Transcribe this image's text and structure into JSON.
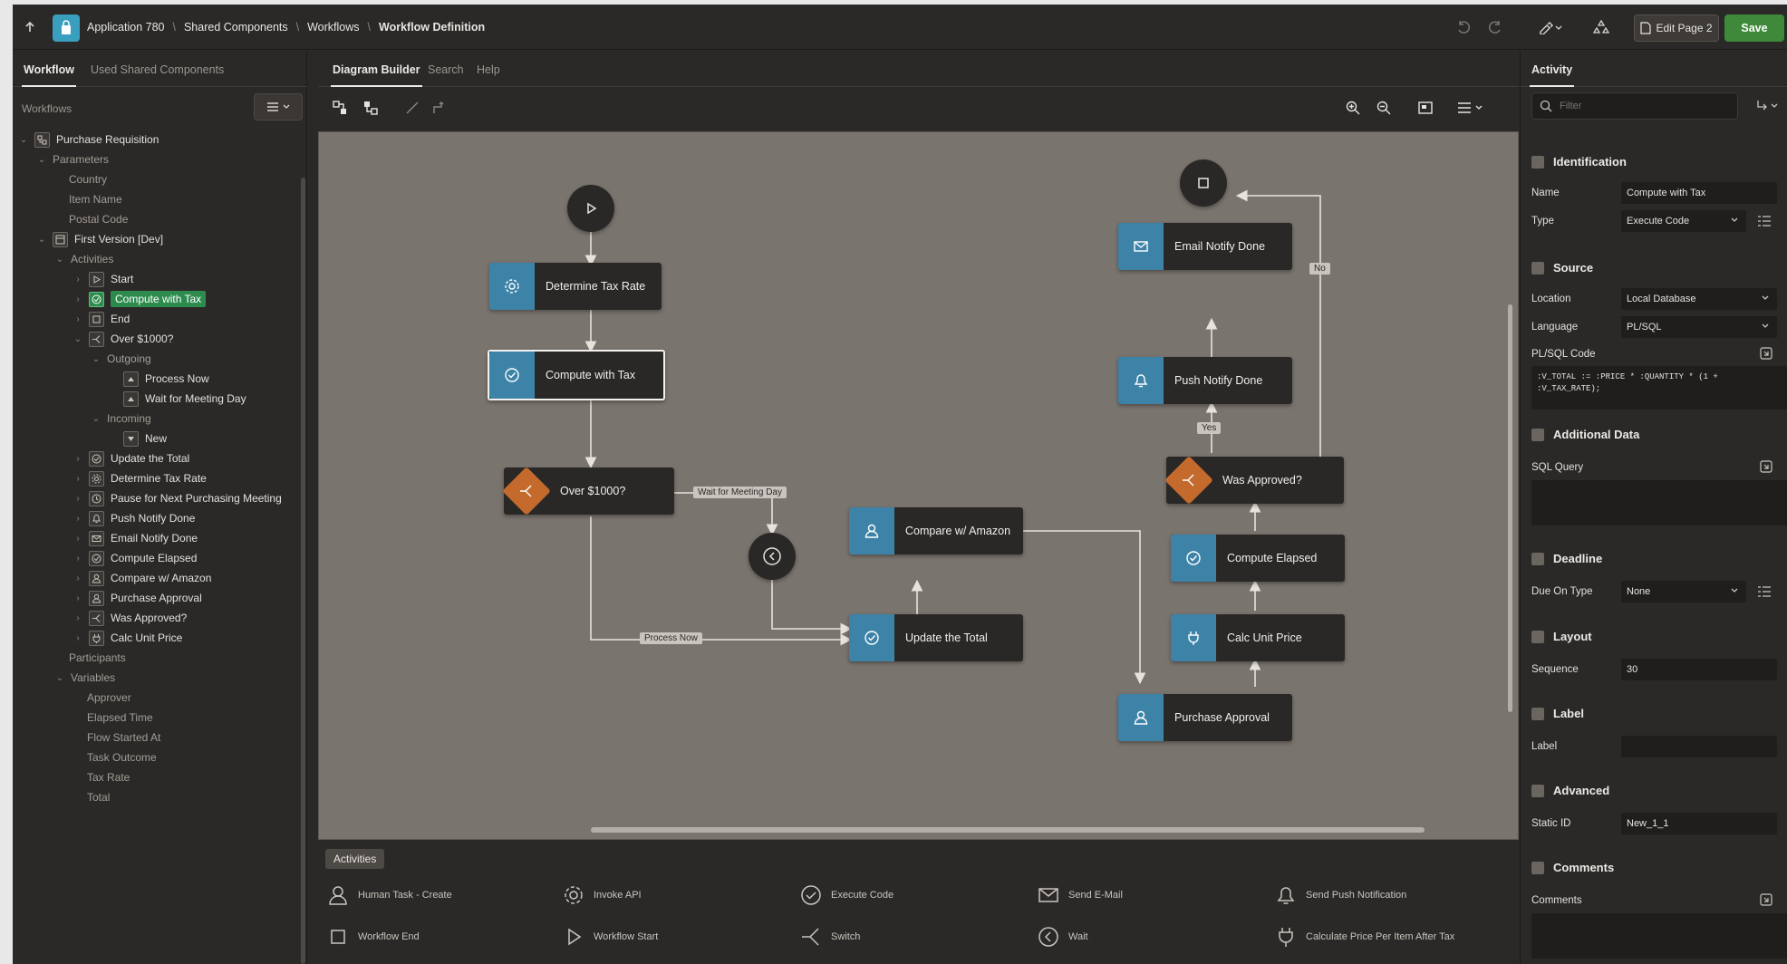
{
  "topbar": {
    "breadcrumbs": [
      "Application 780",
      "Shared Components",
      "Workflows",
      "Workflow Definition"
    ],
    "edit_page_label": "Edit Page 2",
    "save_label": "Save"
  },
  "left_panel": {
    "tabs": [
      "Workflow",
      "Used Shared Components"
    ],
    "section_label": "Workflows",
    "tree": [
      {
        "label": "Purchase Requisition"
      },
      {
        "label": "Parameters"
      },
      {
        "label": "Country"
      },
      {
        "label": "Item Name"
      },
      {
        "label": "Postal Code"
      },
      {
        "label": "First Version [Dev]"
      },
      {
        "label": "Activities"
      },
      {
        "label": "Start"
      },
      {
        "label": "Compute with Tax"
      },
      {
        "label": "End"
      },
      {
        "label": "Over $1000?"
      },
      {
        "label": "Outgoing"
      },
      {
        "label": "Process Now"
      },
      {
        "label": "Wait for Meeting Day"
      },
      {
        "label": "Incoming"
      },
      {
        "label": "New"
      },
      {
        "label": "Update the Total"
      },
      {
        "label": "Determine Tax Rate"
      },
      {
        "label": "Pause for Next Purchasing Meeting"
      },
      {
        "label": "Push Notify Done"
      },
      {
        "label": "Email Notify Done"
      },
      {
        "label": "Compute Elapsed"
      },
      {
        "label": "Compare w/ Amazon"
      },
      {
        "label": "Purchase Approval"
      },
      {
        "label": "Was Approved?"
      },
      {
        "label": "Calc Unit Price"
      },
      {
        "label": "Participants"
      },
      {
        "label": "Variables"
      },
      {
        "label": "Approver"
      },
      {
        "label": "Elapsed Time"
      },
      {
        "label": "Flow Started At"
      },
      {
        "label": "Task Outcome"
      },
      {
        "label": "Tax Rate"
      },
      {
        "label": "Total"
      }
    ]
  },
  "center": {
    "tabs": [
      "Diagram Builder",
      "Search",
      "Help"
    ],
    "nodes": {
      "determine_tax_rate": "Determine Tax Rate",
      "compute_with_tax": "Compute with Tax",
      "over_1000": "Over $1000?",
      "compare_amazon": "Compare w/ Amazon",
      "update_total": "Update the Total",
      "email_notify_done": "Email Notify Done",
      "push_notify_done": "Push Notify Done",
      "was_approved": "Was Approved?",
      "compute_elapsed": "Compute Elapsed",
      "calc_unit_price": "Calc Unit Price",
      "purchase_approval": "Purchase Approval"
    },
    "connector_labels": {
      "wait_for_meeting_day": "Wait for Meeting Day",
      "process_now": "Process Now",
      "no": "No",
      "yes": "Yes"
    },
    "palette": {
      "tab_label": "Activities",
      "items": [
        "Human Task - Create",
        "Invoke API",
        "Execute Code",
        "Send E-Mail",
        "Send Push Notification",
        "Workflow End",
        "Workflow Start",
        "Switch",
        "Wait",
        "Calculate Price Per Item After Tax"
      ]
    }
  },
  "right_panel": {
    "tab_label": "Activity",
    "filter_placeholder": "Filter",
    "sections": {
      "identification": "Identification",
      "source": "Source",
      "additional_data": "Additional Data",
      "deadline": "Deadline",
      "layout": "Layout",
      "label": "Label",
      "advanced": "Advanced",
      "comments": "Comments"
    },
    "props": {
      "name_label": "Name",
      "name_value": "Compute with Tax",
      "type_label": "Type",
      "type_value": "Execute Code",
      "location_label": "Location",
      "location_value": "Local Database",
      "language_label": "Language",
      "language_value": "PL/SQL",
      "plsql_label": "PL/SQL Code",
      "plsql_code": ":V_TOTAL := :PRICE * :QUANTITY * (1 + :V_TAX_RATE);",
      "sql_query_label": "SQL Query",
      "due_on_type_label": "Due On Type",
      "due_on_type_value": "None",
      "sequence_label": "Sequence",
      "sequence_value": "30",
      "label_label": "Label",
      "label_value": "",
      "static_id_label": "Static ID",
      "static_id_value": "New_1_1",
      "comments_label": "Comments"
    }
  }
}
